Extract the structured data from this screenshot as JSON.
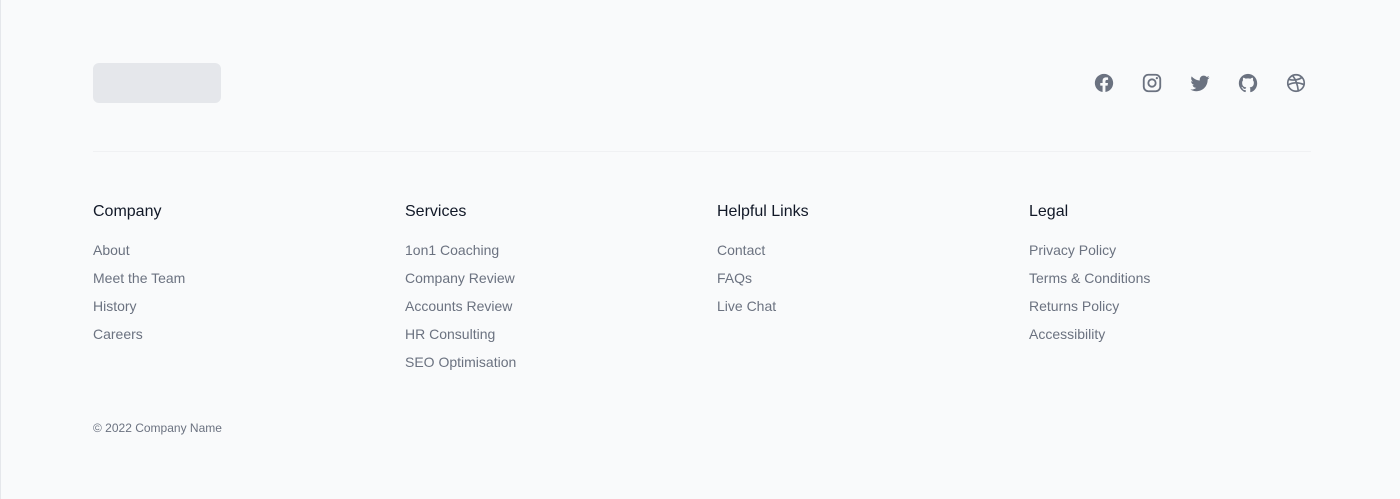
{
  "social_links": [
    {
      "name": "Facebook",
      "icon": "facebook-icon"
    },
    {
      "name": "Instagram",
      "icon": "instagram-icon"
    },
    {
      "name": "Twitter",
      "icon": "twitter-icon"
    },
    {
      "name": "GitHub",
      "icon": "github-icon"
    },
    {
      "name": "Dribbble",
      "icon": "dribbble-icon"
    }
  ],
  "columns": [
    {
      "title": "Company",
      "links": [
        "About",
        "Meet the Team",
        "History",
        "Careers"
      ]
    },
    {
      "title": "Services",
      "links": [
        "1on1 Coaching",
        "Company Review",
        "Accounts Review",
        "HR Consulting",
        "SEO Optimisation"
      ]
    },
    {
      "title": "Helpful Links",
      "links": [
        "Contact",
        "FAQs",
        "Live Chat"
      ]
    },
    {
      "title": "Legal",
      "links": [
        "Privacy Policy",
        "Terms & Conditions",
        "Returns Policy",
        "Accessibility"
      ]
    }
  ],
  "copyright": "© 2022 Company Name",
  "colors": {
    "background": "#f9fafb",
    "heading": "#111827",
    "link": "#6b7280",
    "icon": "#6b7280",
    "placeholder": "#e5e7eb"
  }
}
